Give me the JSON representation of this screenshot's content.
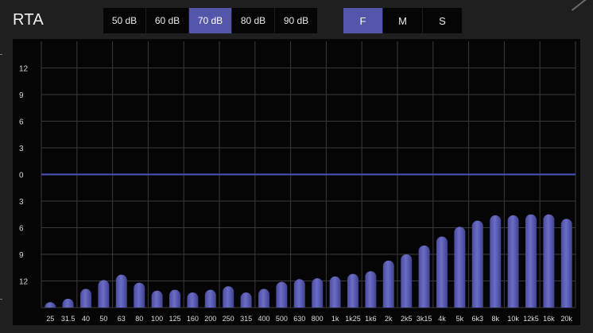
{
  "header": {
    "title": "RTA"
  },
  "db_buttons": [
    {
      "label": "50 dB",
      "active": false
    },
    {
      "label": "60 dB",
      "active": false
    },
    {
      "label": "70 dB",
      "active": true
    },
    {
      "label": "80 dB",
      "active": false
    },
    {
      "label": "90 dB",
      "active": false
    }
  ],
  "mode_buttons": [
    {
      "label": "F",
      "active": true
    },
    {
      "label": "M",
      "active": false
    },
    {
      "label": "S",
      "active": false
    }
  ],
  "colors": {
    "accent": "#5457a9",
    "bar": "#6a6dc4",
    "zero_line": "#4b55b8",
    "grid": "#3a3a3e",
    "background": "#050506"
  },
  "chart_data": {
    "type": "bar",
    "title": "",
    "xlabel": "",
    "ylabel": "",
    "ylim": [
      -15,
      15
    ],
    "y_tick_values": [
      12,
      9,
      6,
      3,
      0,
      -3,
      -6,
      -9,
      -12
    ],
    "y_tick_labels": [
      "12",
      "9",
      "6",
      "3",
      "0",
      "3",
      "6",
      "9",
      "12"
    ],
    "grid": true,
    "categories": [
      "25",
      "31.5",
      "40",
      "50",
      "63",
      "80",
      "100",
      "125",
      "160",
      "200",
      "250",
      "315",
      "400",
      "500",
      "630",
      "800",
      "1k",
      "1k25",
      "1k6",
      "2k",
      "2k5",
      "3k15",
      "4k",
      "5k",
      "6k3",
      "8k",
      "10k",
      "12k5",
      "16k",
      "20k"
    ],
    "values": [
      -14.4,
      -14.0,
      -12.9,
      -11.9,
      -11.3,
      -12.2,
      -13.1,
      -13.0,
      -13.3,
      -13.0,
      -12.6,
      -13.3,
      -12.9,
      -12.1,
      -11.8,
      -11.7,
      -11.5,
      -11.2,
      -10.9,
      -9.7,
      -9.0,
      -8.0,
      -7.0,
      -5.9,
      -5.2,
      -4.6,
      -4.6,
      -4.5,
      -4.5,
      -5.0
    ]
  }
}
